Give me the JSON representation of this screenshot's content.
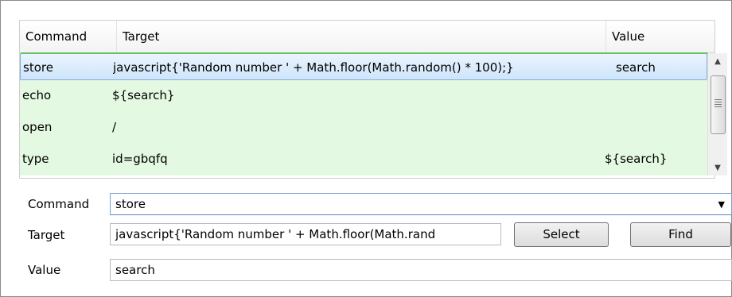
{
  "table": {
    "columns": [
      "Command",
      "Target",
      "Value"
    ],
    "rows": [
      {
        "command": "store",
        "target": "javascript{'Random number ' + Math.floor(Math.random() * 100);}",
        "value": "search"
      },
      {
        "command": "echo",
        "target": "${search}",
        "value": ""
      },
      {
        "command": "open",
        "target": "/",
        "value": ""
      },
      {
        "command": "type",
        "target": "id=gbqfq",
        "value": "${search}"
      }
    ],
    "selected_row": 0,
    "row_bg_color": "#e4f9e1",
    "selected_border_color": "#84acdd"
  },
  "form": {
    "command_label": "Command",
    "command_value": "store",
    "target_label": "Target",
    "target_value": "javascript{'Random number ' + Math.floor(Math.rand",
    "value_label": "Value",
    "value_value": "search",
    "select_button": "Select",
    "find_button": "Find"
  },
  "icons": {
    "scroll_up": "triangle-up-icon",
    "scroll_down": "triangle-down-icon",
    "dropdown": "chevron-down-icon"
  }
}
